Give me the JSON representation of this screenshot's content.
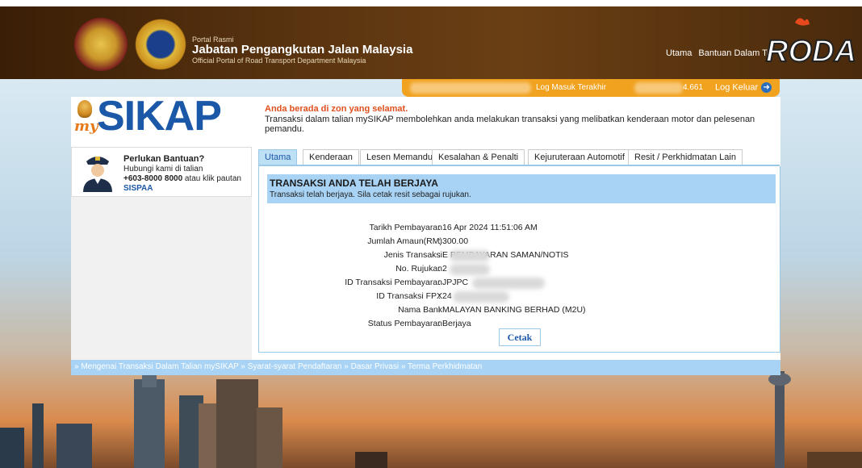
{
  "header": {
    "portal_small": "Portal Rasmi",
    "portal_title": "Jabatan Pengangkutan Jalan Malaysia",
    "portal_sub": "Official Portal of Road Transport Department Malaysia",
    "nav": [
      "Utama",
      "Bantuan Dalam Ta"
    ],
    "watermark": "RODA PANAS"
  },
  "login_bar": {
    "last_login": "Log Masuk Terakhir",
    "ip_fragment": "4.661",
    "logout": "Log Keluar"
  },
  "logo": {
    "prefix": "my",
    "name": "SIKAP"
  },
  "notice": {
    "safe_zone": "Anda berada di zon yang selamat.",
    "description": "Transaksi dalam talian mySIKAP membolehkan anda melakukan transaksi yang melibatkan kenderaan motor dan pelesenan pemandu."
  },
  "help": {
    "title": "Perlukan Bantuan?",
    "line1": "Hubungi kami di talian",
    "phone": "+603-8000 8000",
    "line2_suffix": " atau klik pautan",
    "link": "SISPAA"
  },
  "tabs": [
    "Utama",
    "Kenderaan",
    "Lesen Memandu",
    "Kesalahan & Penalti",
    "Kejuruteraan Automotif",
    "Resit / Perkhidmatan Lain"
  ],
  "result": {
    "title": "TRANSAKSI ANDA TELAH BERJAYA",
    "desc": "Transaksi telah berjaya. Sila cetak resit sebagai rujukan."
  },
  "details": [
    {
      "label": "Tarikh Pembayaran",
      "value": "16 Apr 2024 11:51:06 AM"
    },
    {
      "label": "Jumlah Amaun(RM)",
      "value": "300.00"
    },
    {
      "label": "Jenis Transaksi",
      "value": "E                    PEMBAYARAN SAMAN/NOTIS"
    },
    {
      "label": "No. Rujukan",
      "value": "2"
    },
    {
      "label": "ID Transaksi Pembayaran",
      "value": "JPJPC"
    },
    {
      "label": "ID Transaksi FPX",
      "value": "24"
    },
    {
      "label": "Nama Bank",
      "value": "MALAYAN BANKING BERHAD (M2U)"
    },
    {
      "label": "Status Pembayaran",
      "value": "Berjaya"
    }
  ],
  "print_button": "Cetak",
  "footer": {
    "links": [
      "» Mengenai Transaksi Dalam Talian mySIKAP",
      "» Syarat-syarat Pendaftaran",
      "» Dasar Privasi",
      "» Terma Perkhidmatan"
    ]
  },
  "colors": {
    "brand_blue": "#1c58a8",
    "accent_orange": "#f1a21f",
    "notice_red": "#e0501e",
    "panel_blue": "#a8d3f4"
  }
}
